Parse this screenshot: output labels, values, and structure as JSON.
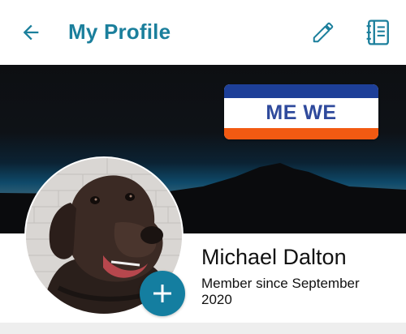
{
  "header": {
    "title": "My Profile",
    "back_icon": "arrow-left-icon",
    "edit_icon": "pencil-icon",
    "notes_icon": "notebook-icon"
  },
  "cover": {
    "badge_text": "ME WE",
    "badge_colors": {
      "top": "#1d3f98",
      "text": "#2f4a9c",
      "bottom": "#f25a12"
    }
  },
  "profile": {
    "name": "Michael Dalton",
    "member_since": "Member since September 2020",
    "add_photo_icon": "plus-icon"
  },
  "colors": {
    "accent": "#1b7f9c",
    "fab": "#147ea0"
  }
}
